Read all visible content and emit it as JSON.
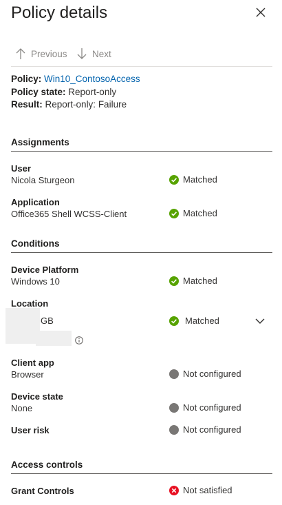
{
  "panel": {
    "title": "Policy details"
  },
  "nav": {
    "previous": "Previous",
    "next": "Next"
  },
  "summary": {
    "policy_label": "Policy:",
    "policy_value": "Win10_ContosoAccess",
    "state_label": "Policy state:",
    "state_value": "Report-only",
    "result_label": "Result:",
    "result_value": "Report-only: Failure"
  },
  "assignments": {
    "heading": "Assignments",
    "user": {
      "label": "User",
      "value": "Nicola Sturgeon",
      "status": "Matched"
    },
    "application": {
      "label": "Application",
      "value": "Office365 Shell WCSS-Client",
      "status": "Matched"
    }
  },
  "conditions": {
    "heading": "Conditions",
    "device_platform": {
      "label": "Device Platform",
      "value": "Windows 10",
      "status": "Matched"
    },
    "location": {
      "label": "Location",
      "value": "GB",
      "status": "Matched"
    },
    "client_app": {
      "label": "Client app",
      "value": "Browser",
      "status": "Not configured"
    },
    "device_state": {
      "label": "Device state",
      "value": "None",
      "status": "Not configured"
    },
    "user_risk": {
      "label": "User risk",
      "status": "Not configured"
    }
  },
  "access_controls": {
    "heading": "Access controls",
    "grant_controls": {
      "label": "Grant Controls",
      "status": "Not satisfied"
    }
  },
  "colors": {
    "matched": "#57a300",
    "not_configured": "#797775",
    "not_satisfied": "#e81123",
    "link": "#0062ad"
  }
}
